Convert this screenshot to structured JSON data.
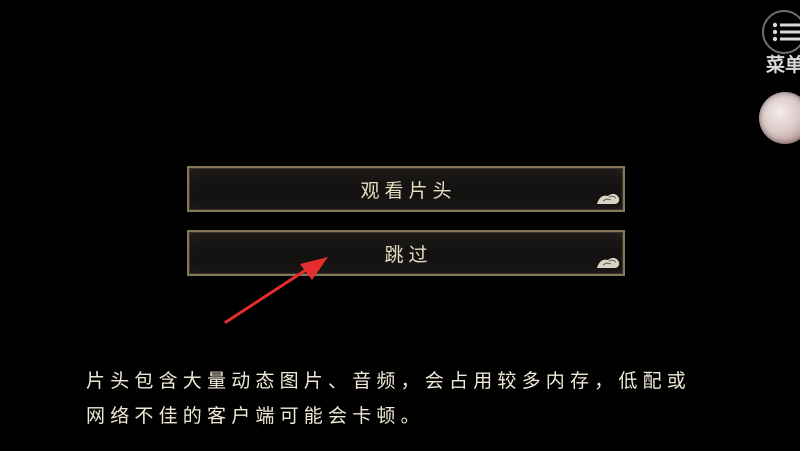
{
  "choices": [
    {
      "label": "观看片头"
    },
    {
      "label": "跳过"
    }
  ],
  "menu": {
    "label": "菜单"
  },
  "notice": {
    "line1": "片头包含大量动态图片、音频，会占用较多内存，低配或",
    "line2": "网络不佳的客户端可能会卡顿。"
  },
  "colors": {
    "background": "#000000",
    "button_border": "#857657",
    "button_text": "#e7dcc2",
    "annotation_arrow": "#e52d2d"
  },
  "icons": {
    "menu": "list-menu-icon",
    "button_decoration": "cloud-swirl-icon",
    "annotation": "red-arrow"
  }
}
